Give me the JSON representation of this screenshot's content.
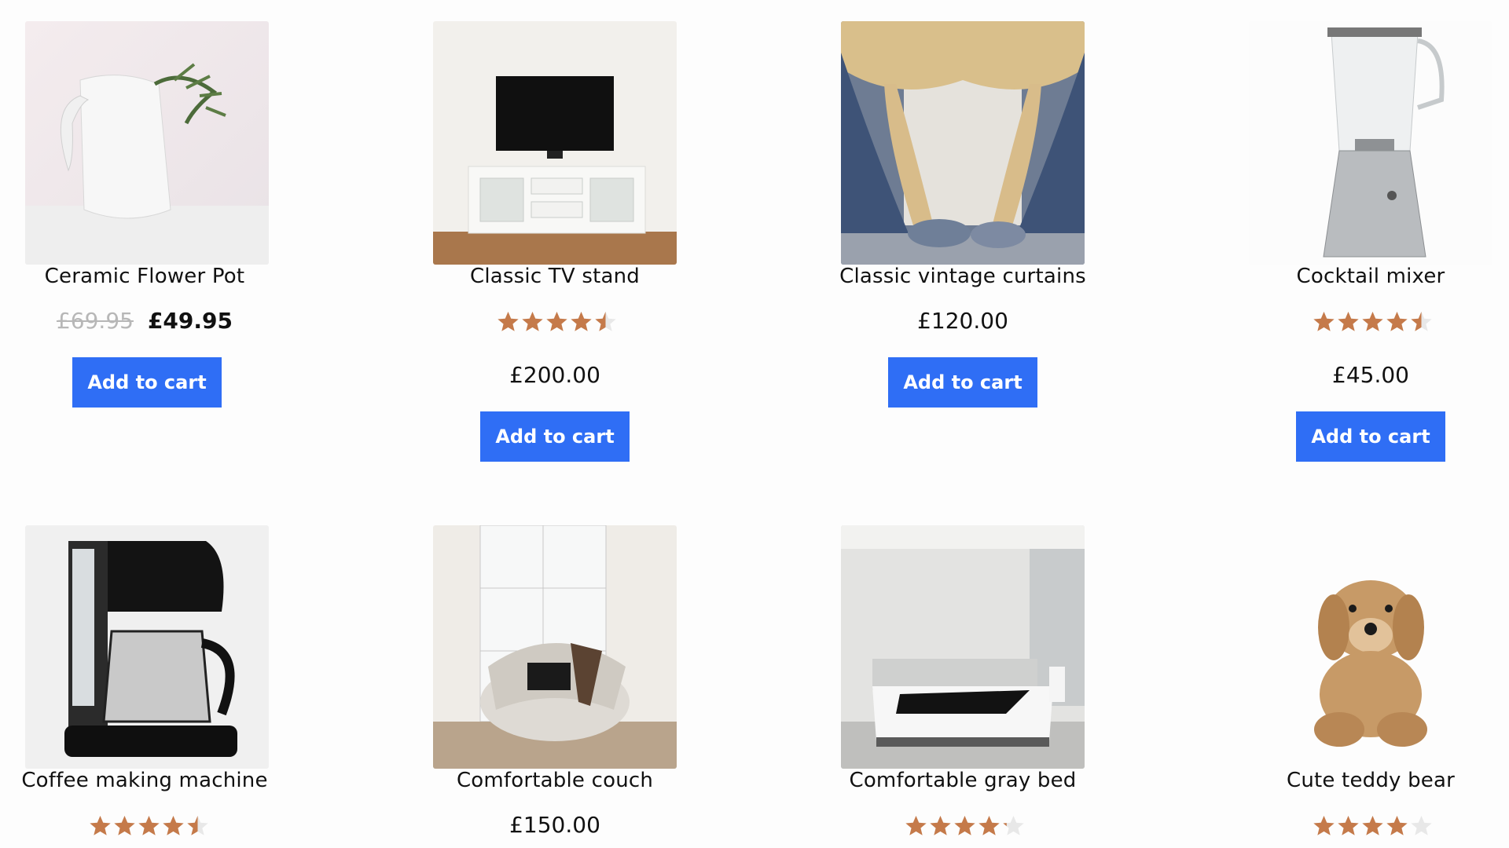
{
  "products": [
    {
      "name": "Ceramic Flower Pot",
      "old_price": "£69.95",
      "price": "£49.95",
      "rating": null,
      "button": "Add to cart",
      "image": "white-ceramic-pitcher"
    },
    {
      "name": "Classic TV stand",
      "old_price": null,
      "price": "£200.00",
      "rating": 4.5,
      "button": "Add to cart",
      "image": "tv-on-white-stand"
    },
    {
      "name": "Classic vintage curtains",
      "old_price": null,
      "price": "£120.00",
      "rating": null,
      "button": "Add to cart",
      "image": "blue-gold-curtains"
    },
    {
      "name": "Cocktail mixer",
      "old_price": null,
      "price": "£45.00",
      "rating": 4.5,
      "button": "Add to cart",
      "image": "silver-blender"
    },
    {
      "name": "Coffee making machine",
      "old_price": null,
      "price": null,
      "rating": 4.5,
      "button": null,
      "image": "black-coffee-maker"
    },
    {
      "name": "Comfortable couch",
      "old_price": null,
      "price": "£150.00",
      "rating": null,
      "button": null,
      "image": "round-armchair"
    },
    {
      "name": "Comfortable gray bed",
      "old_price": null,
      "price": null,
      "rating": 4.2,
      "button": null,
      "image": "gray-bed-room"
    },
    {
      "name": "Cute teddy bear",
      "old_price": null,
      "price": null,
      "rating": 4.0,
      "button": null,
      "image": "plush-dog-toy"
    }
  ],
  "colors": {
    "accent": "#2f6ef5",
    "star": "#c57a4a",
    "star_empty": "#e8e8e8",
    "old_price": "#b7b7b7"
  }
}
